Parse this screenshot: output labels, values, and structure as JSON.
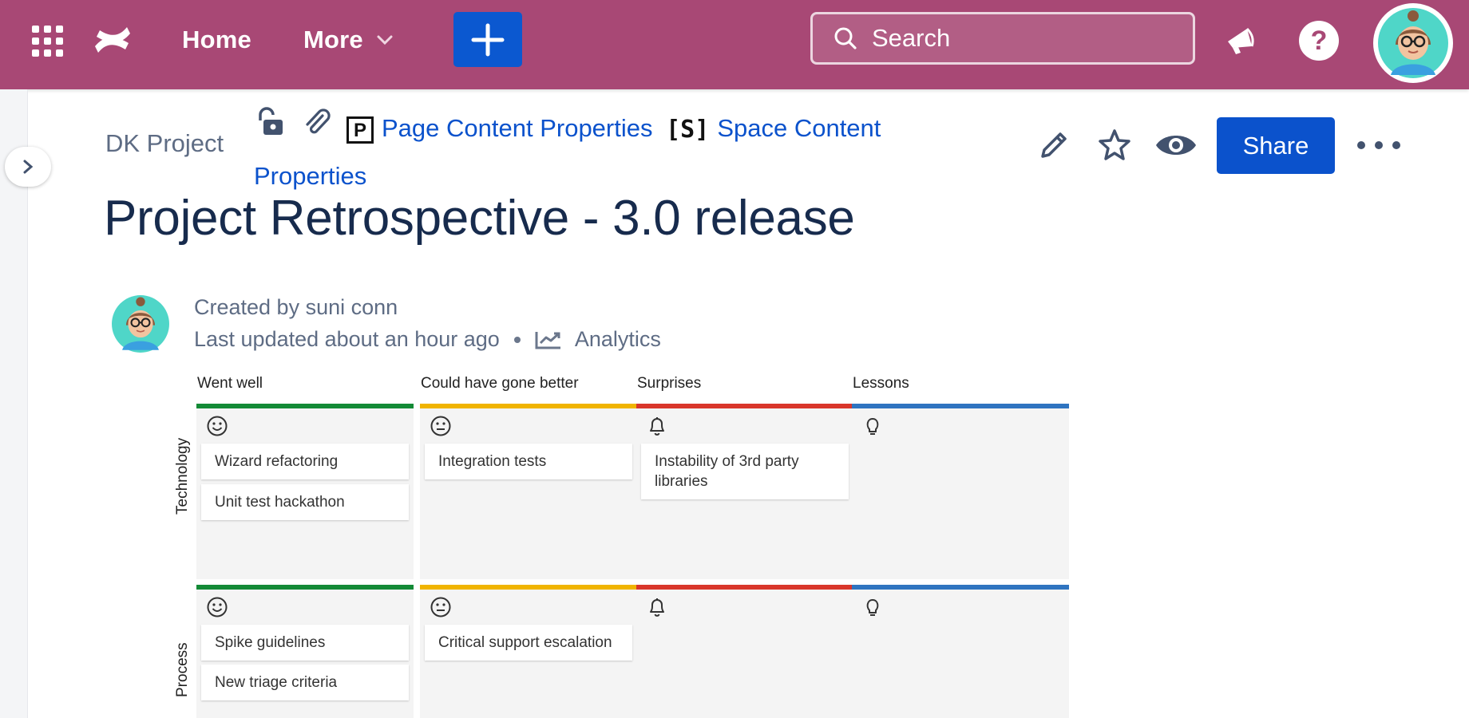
{
  "nav": {
    "home_label": "Home",
    "more_label": "More",
    "search_placeholder": "Search",
    "icons": {
      "app_switcher": "app-switcher-grid-icon",
      "logo": "confluence-logo",
      "create": "plus-icon",
      "search": "search-icon",
      "notifications": "megaphone-icon",
      "help": "help-icon",
      "avatar": "user-avatar"
    },
    "colors": {
      "bar": "#a84875",
      "create_button": "#0b58d0"
    }
  },
  "breadcrumbs": {
    "space": "DK Project",
    "links": [
      "Page Content Properties",
      "Space Content Properties"
    ],
    "macro_badges": [
      "P",
      "[S]"
    ]
  },
  "page_actions": {
    "share_label": "Share",
    "icons": [
      "edit-icon",
      "star-icon",
      "watch-icon",
      "more-icon"
    ],
    "share_color": "#0b52cc"
  },
  "page": {
    "title": "Project Retrospective - 3.0 release",
    "created_by": "Created by suni conn",
    "last_updated": "Last updated about an hour ago",
    "analytics_label": "Analytics"
  },
  "board": {
    "columns": [
      {
        "title": "Went well",
        "color": "#138a36",
        "icon": "smile-icon"
      },
      {
        "title": "Could have gone better",
        "color": "#f0b400",
        "icon": "neutral-face-icon"
      },
      {
        "title": "Surprises",
        "color": "#d9362b",
        "icon": "bell-icon"
      },
      {
        "title": "Lessons",
        "color": "#2f74c0",
        "icon": "lightbulb-icon"
      }
    ],
    "rows": [
      {
        "label": "Technology",
        "cells": [
          [
            "Wizard refactoring",
            "Unit test hackathon"
          ],
          [
            "Integration tests"
          ],
          [
            "Instability of 3rd party libraries"
          ],
          []
        ]
      },
      {
        "label": "Process",
        "cells": [
          [
            "Spike guidelines",
            "New triage criteria"
          ],
          [
            "Critical support escalation"
          ],
          [],
          []
        ]
      }
    ]
  }
}
